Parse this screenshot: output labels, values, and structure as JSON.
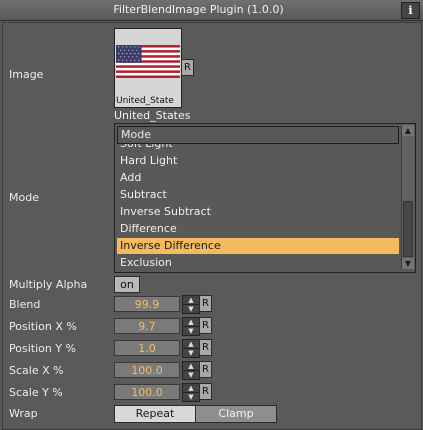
{
  "window": {
    "title": "FilterBlendImage Plugin (1.0.0)",
    "info_icon": "i"
  },
  "image": {
    "label": "Image",
    "thumbnail_caption": "United_State",
    "name": "United_States",
    "reset_label": "R"
  },
  "mode": {
    "label": "Mode",
    "header": "Mode",
    "items": [
      "Soft Light",
      "Hard Light",
      "Add",
      "Subtract",
      "Inverse Subtract",
      "Difference",
      "Inverse Difference",
      "Exclusion"
    ],
    "selected": "Inverse Difference"
  },
  "multiply_alpha": {
    "label": "Multiply Alpha",
    "value": "on"
  },
  "params": [
    {
      "label": "Blend",
      "value": "99.9",
      "reset_label": "R"
    },
    {
      "label": "Position X %",
      "value": "9.7",
      "reset_label": "R"
    },
    {
      "label": "Position Y %",
      "value": "1.0",
      "reset_label": "R"
    },
    {
      "label": "Scale X %",
      "value": "100.0",
      "reset_label": "R"
    },
    {
      "label": "Scale Y %",
      "value": "100.0",
      "reset_label": "R"
    }
  ],
  "wrap": {
    "label": "Wrap",
    "options": [
      "Repeat",
      "Clamp"
    ],
    "selected": "Repeat"
  },
  "colors": {
    "background": "#5a5a5a",
    "selection": "#f3bb5c",
    "value_text": "#f3bd68"
  },
  "icons": {
    "info": "info-icon",
    "scroll_up": "arrow-up-icon",
    "scroll_down": "arrow-down-icon",
    "spin_up": "spin-up-icon",
    "spin_down": "spin-down-icon"
  }
}
